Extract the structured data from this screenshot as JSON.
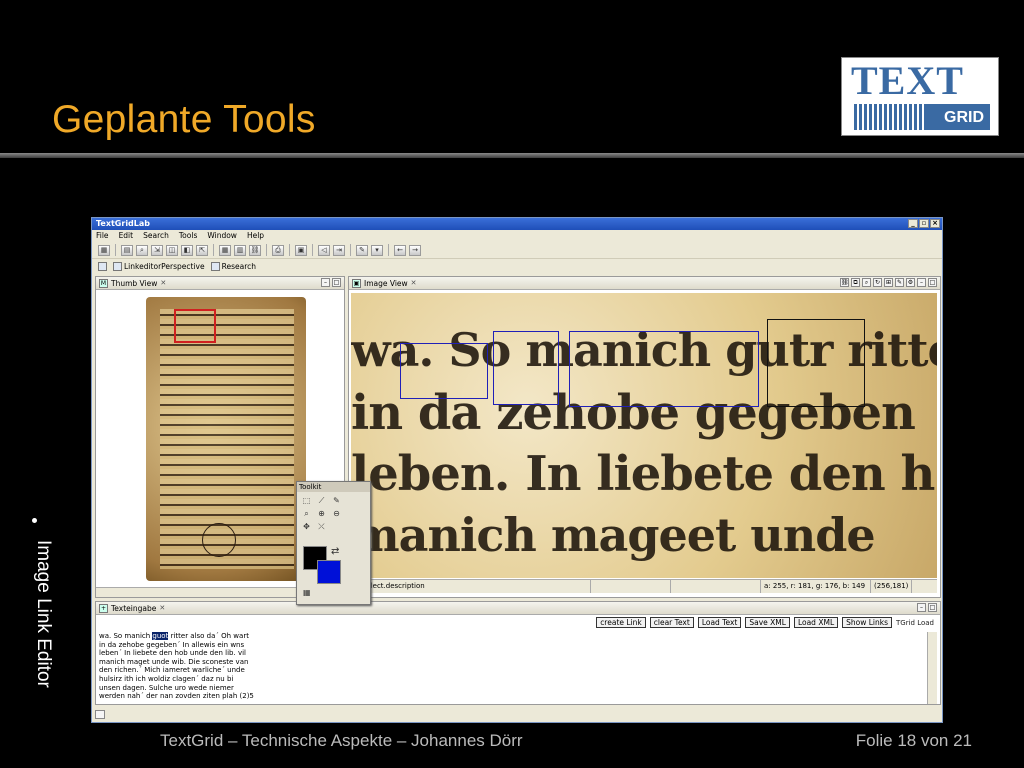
{
  "slide": {
    "title": "Geplante Tools",
    "bullet": "Image Link Editor",
    "footer_text": "TextGrid  –  Technische Aspekte  –  Johannes Dörr",
    "footer_page": "Folie 18 von 21",
    "title_color": "#f0a928"
  },
  "logo": {
    "text": "TEXT",
    "sub": "GRID",
    "color": "#3a6aa3"
  },
  "app": {
    "window_title": "TextGridLab",
    "menu": [
      "File",
      "Edit",
      "Search",
      "Tools",
      "Window",
      "Help"
    ],
    "perspectives": [
      "LinkeditorPerspective",
      "Research"
    ],
    "thumb_view": {
      "tab": "Thumb View"
    },
    "image_view": {
      "tab": "Image View",
      "scan_lines": [
        "wa. So manich gutr ritter",
        "in da zehobe gegeben",
        "leben. In liebete den h",
        "manich mageet unde"
      ],
      "status": [
        "ar.select.description",
        "a: 255, r: 181, g: 176, b: 149",
        "(256,181)"
      ]
    },
    "toolkit": {
      "title": "Toolkit"
    },
    "text_view": {
      "tab": "Texteingabe",
      "buttons": [
        "create Link",
        "clear Text",
        "Load Text",
        "Save XML",
        "Load XML",
        "Show Links"
      ],
      "extra": "TGrid Load",
      "lines": [
        {
          "before": "wa. So manich ",
          "highlight": "guot",
          "after": " ritter also da´ Oh wart"
        },
        {
          "before": "in da zehobe gegeben´ In allewis ein wns",
          "highlight": "",
          "after": ""
        },
        {
          "before": "leben´ In liebete den hob unde den lib. vil",
          "highlight": "",
          "after": ""
        },
        {
          "before": "manich maget unde wib. Die sconeste van",
          "highlight": "",
          "after": ""
        },
        {
          "before": "den richen.´ Mich iameret warliche´ unde",
          "highlight": "",
          "after": ""
        },
        {
          "before": "hulsirz ith ich woldiz clagen´ daz nu bi",
          "highlight": "",
          "after": ""
        },
        {
          "before": "unsen dagen. Sulche uro wede niemer",
          "highlight": "",
          "after": ""
        },
        {
          "before": "werden nah´ der nan zovden ziten plah (2)5",
          "highlight": "",
          "after": ""
        }
      ]
    }
  }
}
